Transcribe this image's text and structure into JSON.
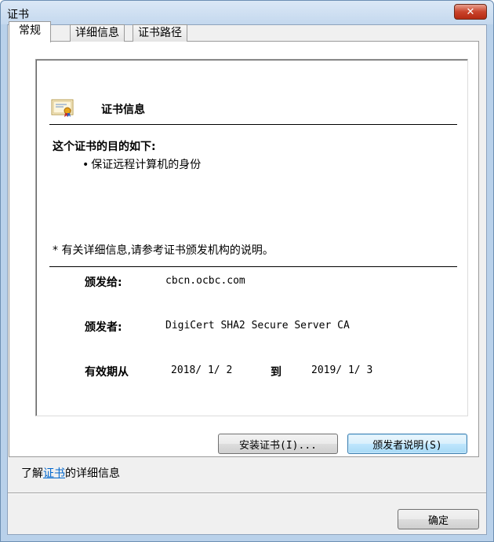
{
  "window": {
    "title": "证书",
    "close_label": "✕"
  },
  "tabs": [
    {
      "label": "常规"
    },
    {
      "label": "详细信息"
    },
    {
      "label": "证书路径"
    }
  ],
  "cert": {
    "header": "证书信息",
    "purpose_title": "这个证书的目的如下:",
    "purposes": [
      "保证远程计算机的身份"
    ],
    "note": "* 有关详细信息,请参考证书颁发机构的说明。",
    "issued_to_label": "颁发给:",
    "issued_to_value": "cbcn.ocbc.com",
    "issued_by_label": "颁发者:",
    "issued_by_value": "DigiCert SHA2 Secure Server CA",
    "valid_from_label": "有效期从",
    "valid_from_value": "2018/ 1/ 2",
    "valid_to_label": "到",
    "valid_to_value": "2019/ 1/ 3"
  },
  "buttons": {
    "install": "安装证书(I)...",
    "issuer_statement": "颁发者说明(S)",
    "ok": "确定"
  },
  "learn": {
    "prefix": "了解",
    "link": "证书",
    "suffix": "的详细信息"
  }
}
